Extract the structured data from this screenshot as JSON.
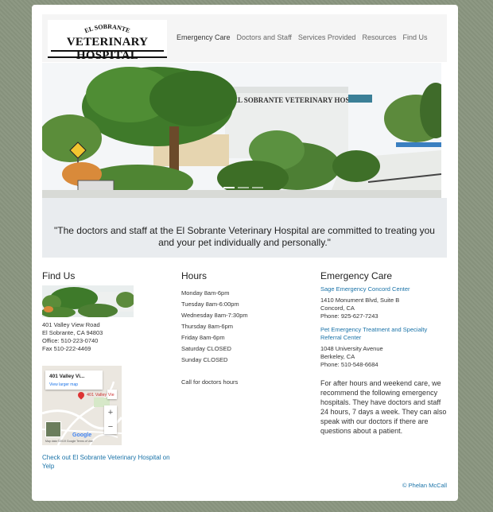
{
  "logo": {
    "arc_text": "EL SOBRANTE",
    "main_text": "VETERINARY HOSPITAL"
  },
  "nav": {
    "items": [
      "Emergency Care",
      "Doctors and Staff",
      "Services Provided",
      "Resources",
      "Find Us"
    ]
  },
  "hero": {
    "building_sign": "EL SOBRANTE VETERINARY HOSPITAL",
    "slide_count": 3,
    "active_slide": 1
  },
  "quote": "\"The doctors and staff at the El Sobrante Veterinary Hospital are committed to treating you and your pet individually and personally.\"",
  "find_us": {
    "heading": "Find Us",
    "address_lines": [
      "401 Valley View Road",
      "El Sobrante, CA 94803",
      "Office: 510-223-0740",
      "Fax 510-222-4469"
    ],
    "map": {
      "card_title": "401 Valley Vi...",
      "card_link": "View larger map",
      "pin_label": "401 Valley Vie",
      "zoom_in": "+",
      "zoom_out": "−",
      "brand": "Google",
      "footer": "Map data ©2019 Google   Terms of Use"
    },
    "yelp_link": "Check out El Sobrante Veterinary Hospital on Yelp"
  },
  "hours": {
    "heading": "Hours",
    "lines": [
      "Monday 8am-6pm",
      "Tuesday 8am-6:00pm",
      "Wednesday 8am-7:30pm",
      "Thursday 8am-6pm",
      "Friday 8am-6pm",
      "Saturday CLOSED",
      "Sunday CLOSED",
      "",
      "Call for doctors hours"
    ]
  },
  "emergency": {
    "heading": "Emergency Care",
    "clinic1": {
      "name": "Sage Emergency Concord Center",
      "line1": "1410 Monument Blvd, Suite B",
      "line2": "Concord, CA",
      "phone": "Phone: 925-627-7243"
    },
    "clinic2": {
      "name": "Pet Emergency Treatment and Specialty Referral Center",
      "line1": "1048 University Avenue",
      "line2": "Berkeley, CA",
      "phone": "Phone: 510-548-6684"
    },
    "paragraph": "For after hours and weekend care, we recommend the following emergency hospitals. They have doctors and staff 24 hours, 7 days a week. They can also speak with our doctors if there are questions about a patient."
  },
  "credit": "© Phelan McCall",
  "colors": {
    "link": "#1a73a8",
    "background": "#8a9680",
    "quote_bg": "#e9ecef",
    "header_bg": "#f5f5f5"
  }
}
